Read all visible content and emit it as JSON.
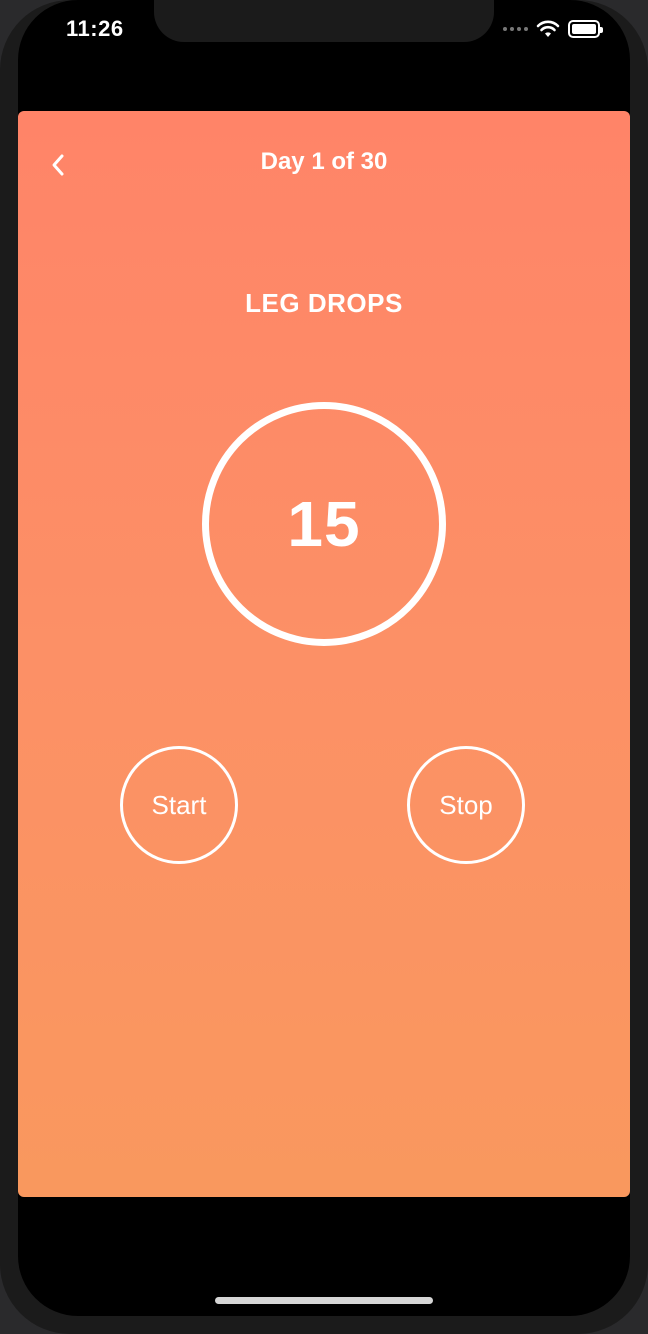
{
  "status_bar": {
    "time": "11:26",
    "icons": [
      "signal-dots-icon",
      "wifi-icon",
      "battery-icon"
    ]
  },
  "header": {
    "back_icon": "chevron-left-icon",
    "title": "Day 1 of 30"
  },
  "exercise": {
    "name": "LEG DROPS",
    "count": "15"
  },
  "controls": {
    "start_label": "Start",
    "stop_label": "Stop"
  },
  "colors": {
    "gradient_top": "#ff8468",
    "gradient_bottom": "#f9985e",
    "text": "#ffffff",
    "background": "#000000"
  }
}
